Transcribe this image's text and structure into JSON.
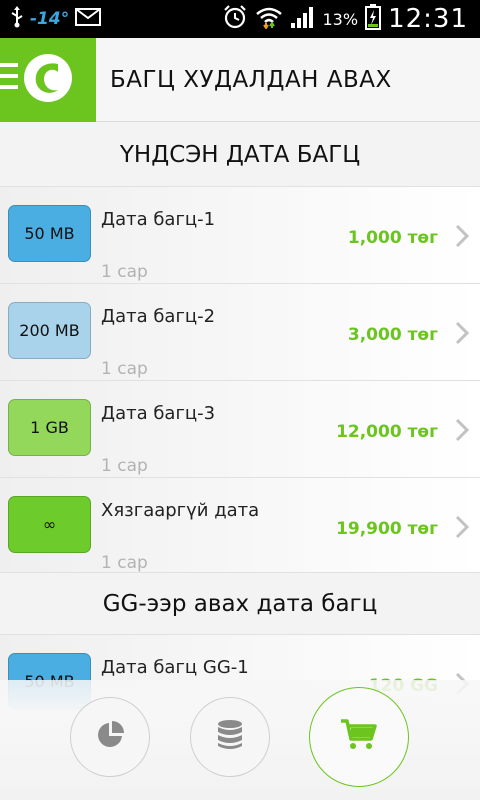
{
  "status_bar": {
    "temperature": "-14°",
    "battery_percent": "13%",
    "time": "12:31",
    "icons": [
      "usb-icon",
      "mail-icon",
      "alarm-icon",
      "wifi-icon",
      "signal-icon",
      "battery-icon"
    ]
  },
  "app_bar": {
    "title": "БАГЦ ХУДАЛДАН АВАХ",
    "brand_color": "#6cc51f"
  },
  "sections": [
    {
      "title": "ҮНДСЭН ДАТА БАГЦ",
      "items": [
        {
          "badge": "50 MB",
          "badge_color": "#4aaee3",
          "name": "Дата багц-1",
          "period": "1 сар",
          "price": "1,000 төг"
        },
        {
          "badge": "200 MB",
          "badge_color": "#a9d2eb",
          "name": "Дата багц-2",
          "period": "1 сар",
          "price": "3,000 төг"
        },
        {
          "badge": "1 GB",
          "badge_color": "#93d85a",
          "name": "Дата багц-3",
          "period": "1 сар",
          "price": "12,000 төг"
        },
        {
          "badge": "∞",
          "badge_color": "#6dcc2c",
          "name": "Хязгааргүй дата",
          "period": "1 сар",
          "price": "19,900 төг"
        }
      ]
    },
    {
      "title": "GG-ээр авах дата багц",
      "items": [
        {
          "badge": "50 MB",
          "badge_color": "#4aaee3",
          "name": "Дата багц GG-1",
          "period": "",
          "price": "120 GG"
        }
      ]
    }
  ],
  "bottom_nav": [
    {
      "icon": "pie-chart-icon",
      "active": false
    },
    {
      "icon": "database-icon",
      "active": false
    },
    {
      "icon": "shopping-cart-icon",
      "active": true
    }
  ]
}
